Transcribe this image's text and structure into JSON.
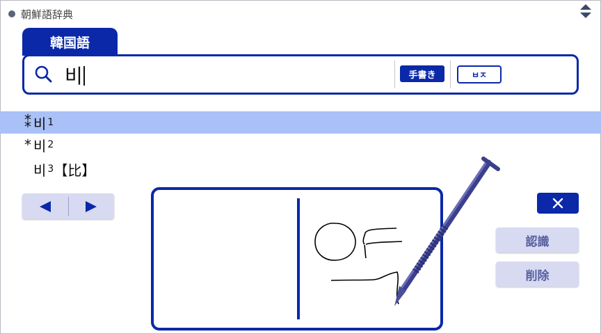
{
  "window": {
    "title": "朝鮮語辞典"
  },
  "tab": {
    "label": "韓国語"
  },
  "search": {
    "value": "비"
  },
  "buttons": {
    "handwriting": "手書き",
    "keyboard": "ㅂㅈ",
    "recognize": "認識",
    "delete": "削除"
  },
  "results": [
    {
      "mark": "⁑",
      "word": "비",
      "num": "1",
      "suffix": "",
      "selected": true
    },
    {
      "mark": "*",
      "word": "비",
      "num": "2",
      "suffix": "",
      "selected": false
    },
    {
      "mark": "",
      "word": "비",
      "num": "3",
      "suffix": "【比】",
      "selected": false
    }
  ],
  "icons": {
    "search": "search-icon",
    "scroll": "scroll-arrows-icon",
    "prev": "left-arrow-icon",
    "next": "right-arrow-icon",
    "close": "close-icon",
    "stylus": "stylus-icon"
  },
  "colors": {
    "accent": "#0a28a8",
    "selection": "#a9c1f7",
    "button_bg": "#d8daf2"
  }
}
